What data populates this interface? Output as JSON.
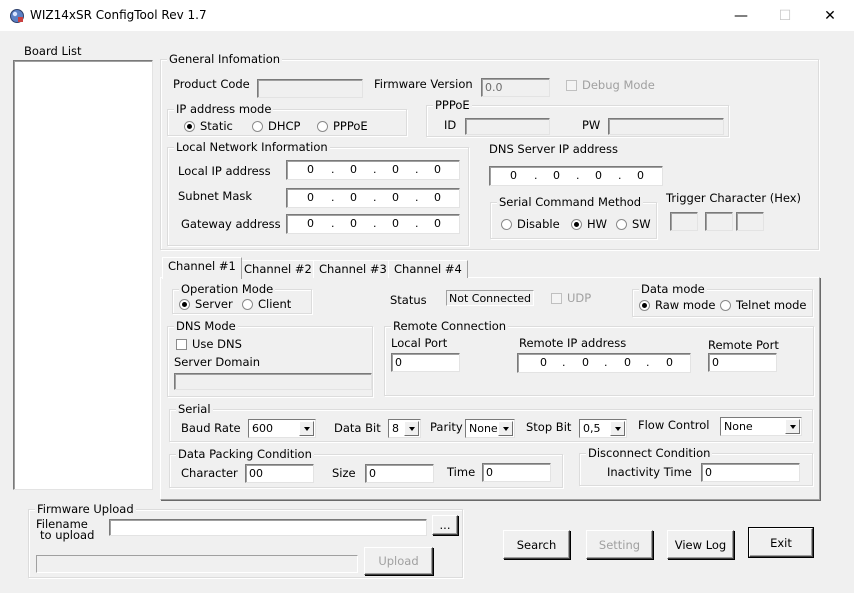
{
  "window": {
    "title": "WIZ14xSR ConfigTool Rev 1.7",
    "minimize_glyph": "—",
    "maximize_glyph": "☐",
    "close_glyph": "✕"
  },
  "board_list": {
    "label": "Board List"
  },
  "general": {
    "title": "General Infomation",
    "product_code_label": "Product Code",
    "product_code_value": "",
    "firmware_version_label": "Firmware Version",
    "firmware_version_value": "0.0",
    "debug_mode_label": "Debug Mode",
    "ip_mode": {
      "title": "IP address mode",
      "options": [
        "Static",
        "DHCP",
        "PPPoE"
      ],
      "selected": "Static"
    },
    "pppoe": {
      "title": "PPPoE",
      "id_label": "ID",
      "id_value": "",
      "pw_label": "PW",
      "pw_value": ""
    },
    "local_net": {
      "title": "Local Network Information",
      "local_ip_label": "Local IP address",
      "local_ip": [
        "0",
        "0",
        "0",
        "0"
      ],
      "subnet_label": "Subnet Mask",
      "subnet": [
        "0",
        "0",
        "0",
        "0"
      ],
      "gateway_label": "Gateway address",
      "gateway": [
        "0",
        "0",
        "0",
        "0"
      ]
    },
    "dns_server": {
      "label": "DNS Server IP address",
      "ip": [
        "0",
        "0",
        "0",
        "0"
      ]
    },
    "serial_cmd": {
      "title": "Serial Command Method",
      "options": [
        "Disable",
        "HW",
        "SW"
      ],
      "selected": "HW"
    },
    "trigger": {
      "label": "Trigger Character (Hex)",
      "values": [
        "",
        "",
        ""
      ]
    }
  },
  "tabs": [
    "Channel #1",
    "Channel #2",
    "Channel #3",
    "Channel #4"
  ],
  "channel": {
    "op_mode": {
      "title": "Operation Mode",
      "options": [
        "Server",
        "Client"
      ],
      "selected": "Server"
    },
    "status_label": "Status",
    "status_value": "Not Connected",
    "udp_label": "UDP",
    "data_mode": {
      "title": "Data mode",
      "options": [
        "Raw mode",
        "Telnet mode"
      ],
      "selected": "Raw mode"
    },
    "dns_mode": {
      "title": "DNS Mode",
      "use_dns_label": "Use DNS",
      "server_domain_label": "Server Domain",
      "server_domain_value": ""
    },
    "remote": {
      "title": "Remote Connection",
      "local_port_label": "Local Port",
      "local_port_value": "0",
      "remote_ip_label": "Remote IP address",
      "remote_ip": [
        "0",
        "0",
        "0",
        "0"
      ],
      "remote_port_label": "Remote Port",
      "remote_port_value": "0"
    },
    "serial": {
      "title": "Serial",
      "baud_label": "Baud Rate",
      "baud_value": "600",
      "databit_label": "Data Bit",
      "databit_value": "8",
      "parity_label": "Parity",
      "parity_value": "None",
      "stopbit_label": "Stop Bit",
      "stopbit_value": "0,5",
      "flow_label": "Flow Control",
      "flow_value": "None"
    },
    "packing": {
      "title": "Data Packing Condition",
      "char_label": "Character",
      "char_value": "00",
      "size_label": "Size",
      "size_value": "0",
      "time_label": "Time",
      "time_value": "0"
    },
    "disconnect": {
      "title": "Disconnect Condition",
      "inactivity_label": "Inactivity Time",
      "inactivity_value": "0"
    }
  },
  "firmware_upload": {
    "title": "Firmware Upload",
    "filename_label_1": "Filename",
    "filename_label_2": "to upload",
    "filename_value": "",
    "browse_label": "...",
    "upload_label": "Upload"
  },
  "buttons": {
    "search": "Search",
    "setting": "Setting",
    "view_log": "View Log",
    "exit": "Exit"
  }
}
